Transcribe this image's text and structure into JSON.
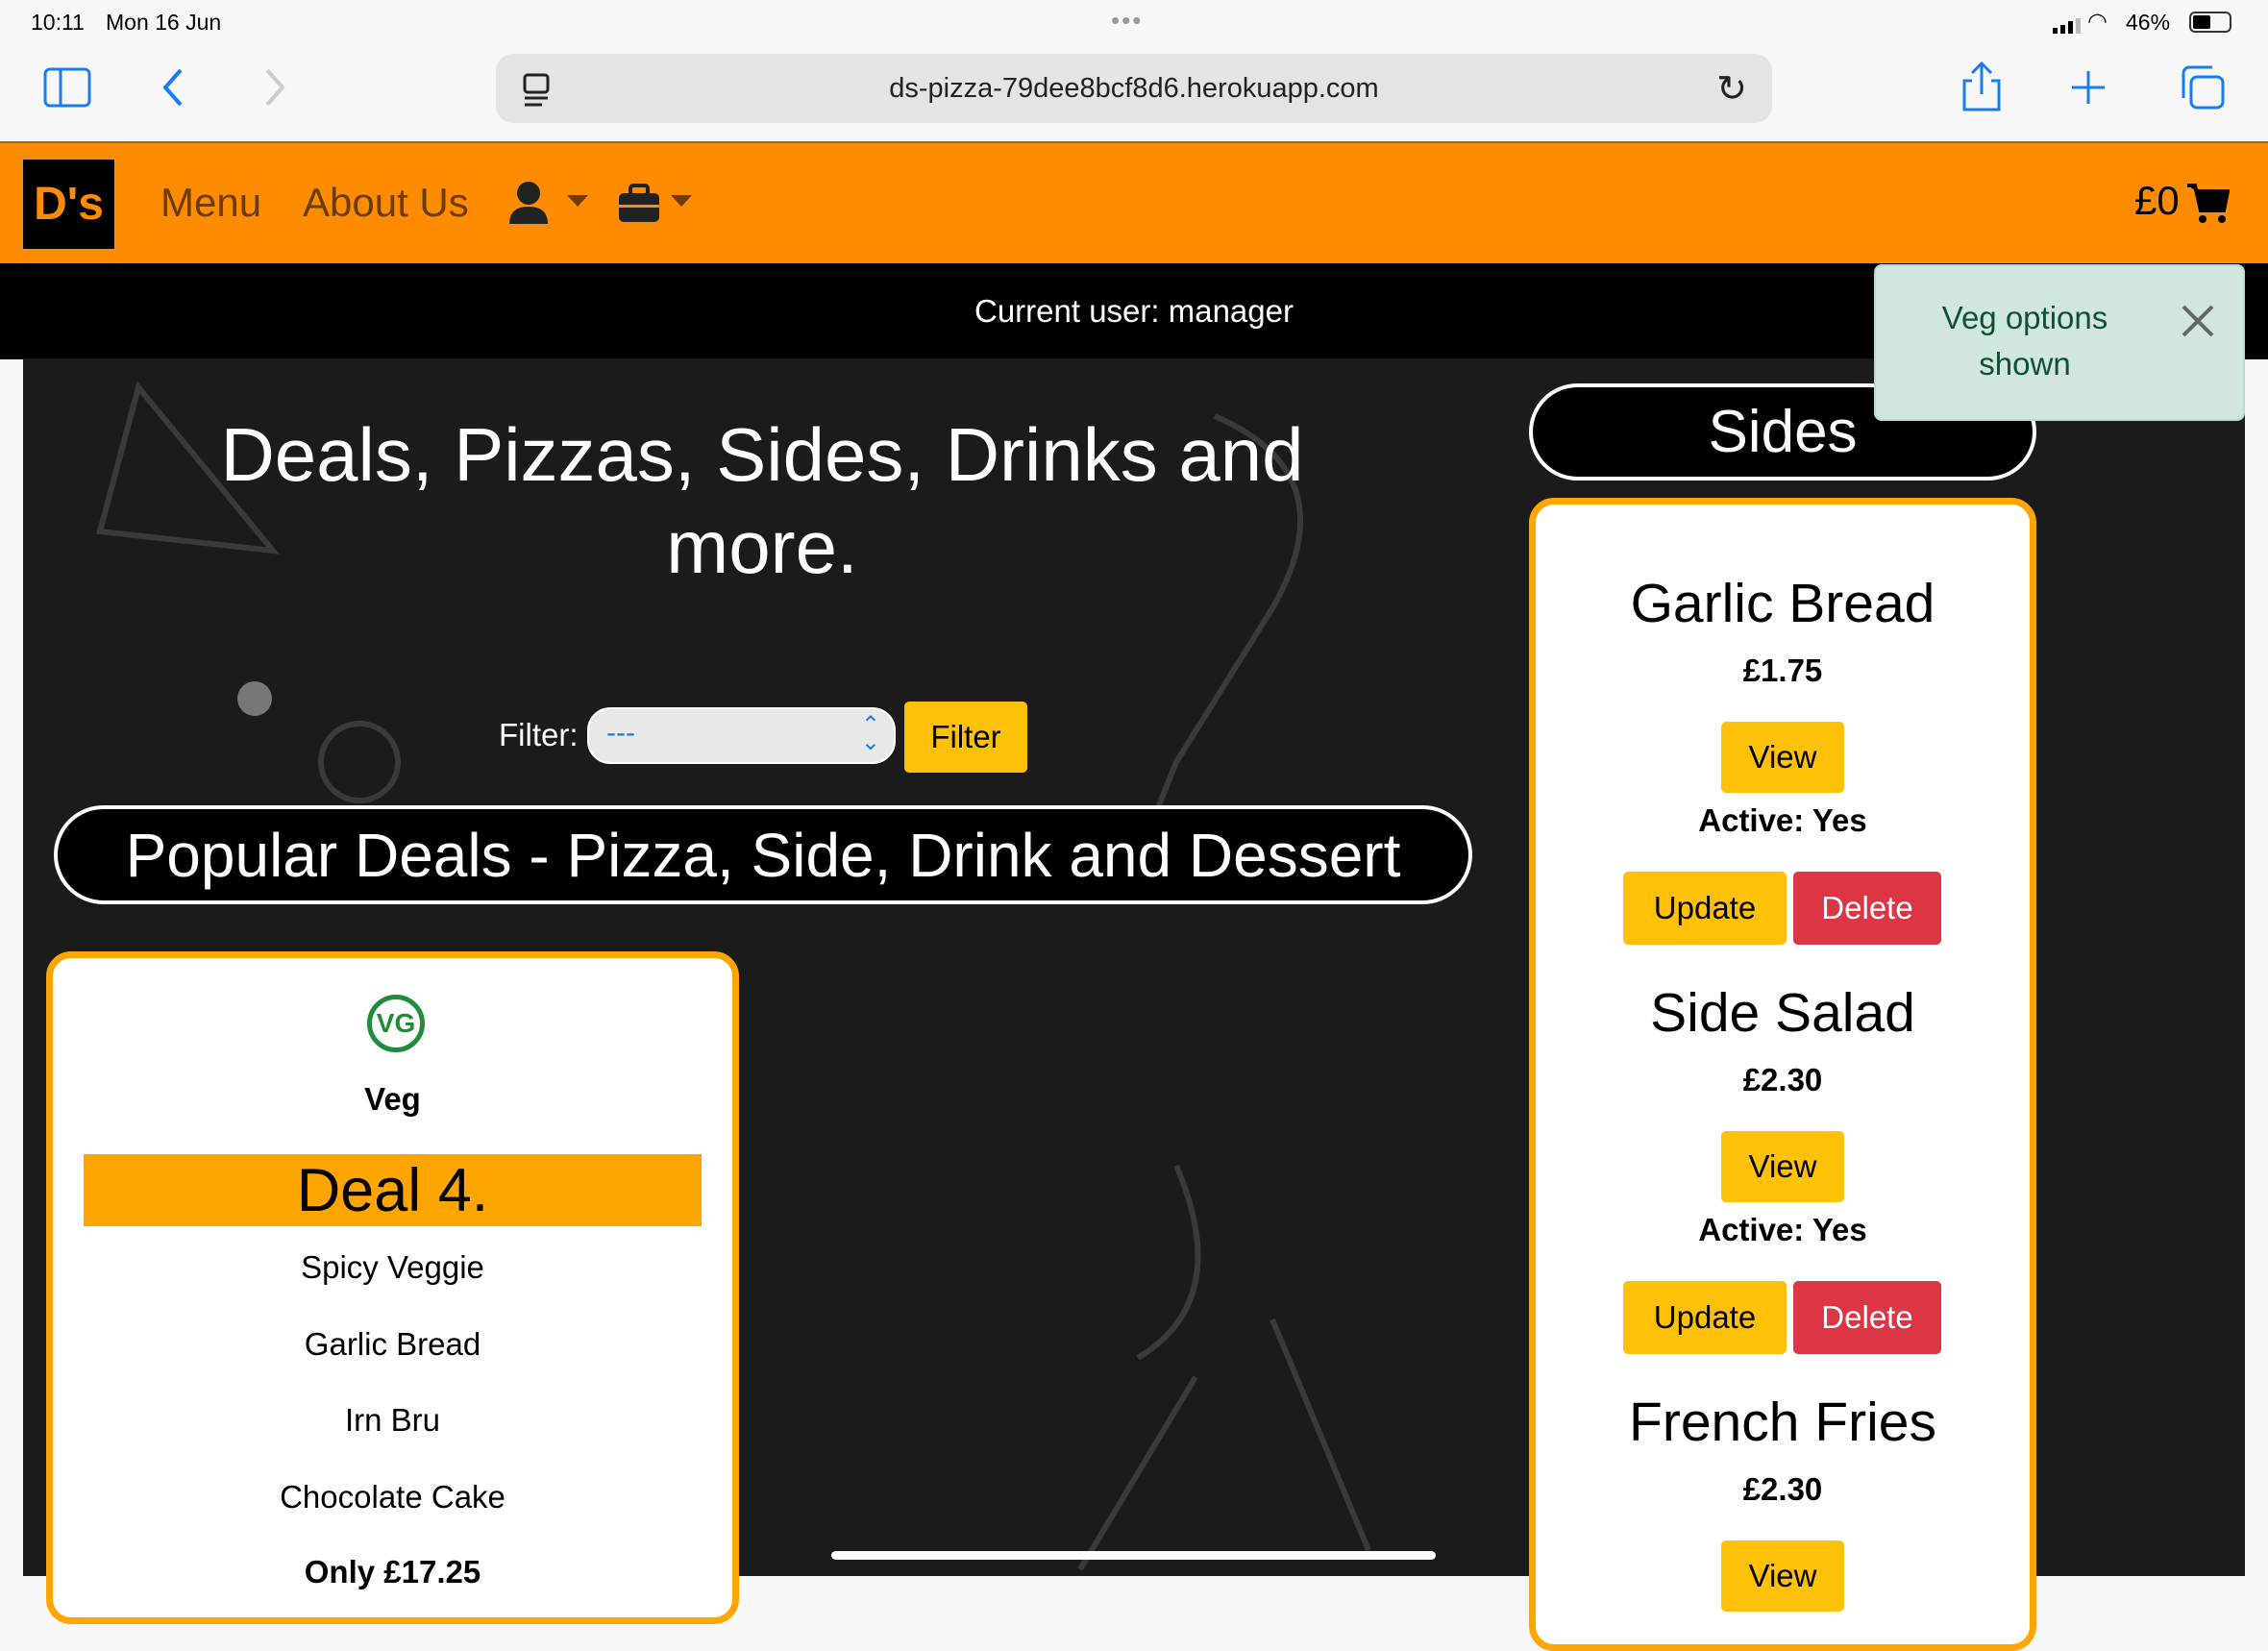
{
  "status_bar": {
    "time": "10:11",
    "date": "Mon 16 Jun",
    "battery": "46%"
  },
  "browser": {
    "url": "ds-pizza-79dee8bcf8d6.herokuapp.com"
  },
  "nav": {
    "logo": "D's",
    "links": [
      "Menu",
      "About Us"
    ],
    "cart_total": "£0"
  },
  "current_user": "Current user: manager",
  "toast": {
    "message": "Veg options shown"
  },
  "hero": {
    "heading": "Deals, Pizzas, Sides, Drinks and more."
  },
  "filter": {
    "label": "Filter:",
    "value": "---",
    "button": "Filter"
  },
  "deals": {
    "heading": "Popular Deals - Pizza, Side, Drink and Dessert",
    "card": {
      "badge": "VG",
      "diet": "Veg",
      "title": "Deal 4.",
      "items": [
        "Spicy Veggie",
        "Garlic Bread",
        "Irn Bru",
        "Chocolate Cake"
      ],
      "price": "Only £17.25"
    }
  },
  "sides": {
    "heading": "Sides",
    "view_label": "View",
    "update_label": "Update",
    "delete_label": "Delete",
    "items": [
      {
        "name": "Garlic Bread",
        "price": "£1.75",
        "active": "Active: Yes"
      },
      {
        "name": "Side Salad",
        "price": "£2.30",
        "active": "Active: Yes"
      },
      {
        "name": "French Fries",
        "price": "£2.30"
      }
    ]
  }
}
